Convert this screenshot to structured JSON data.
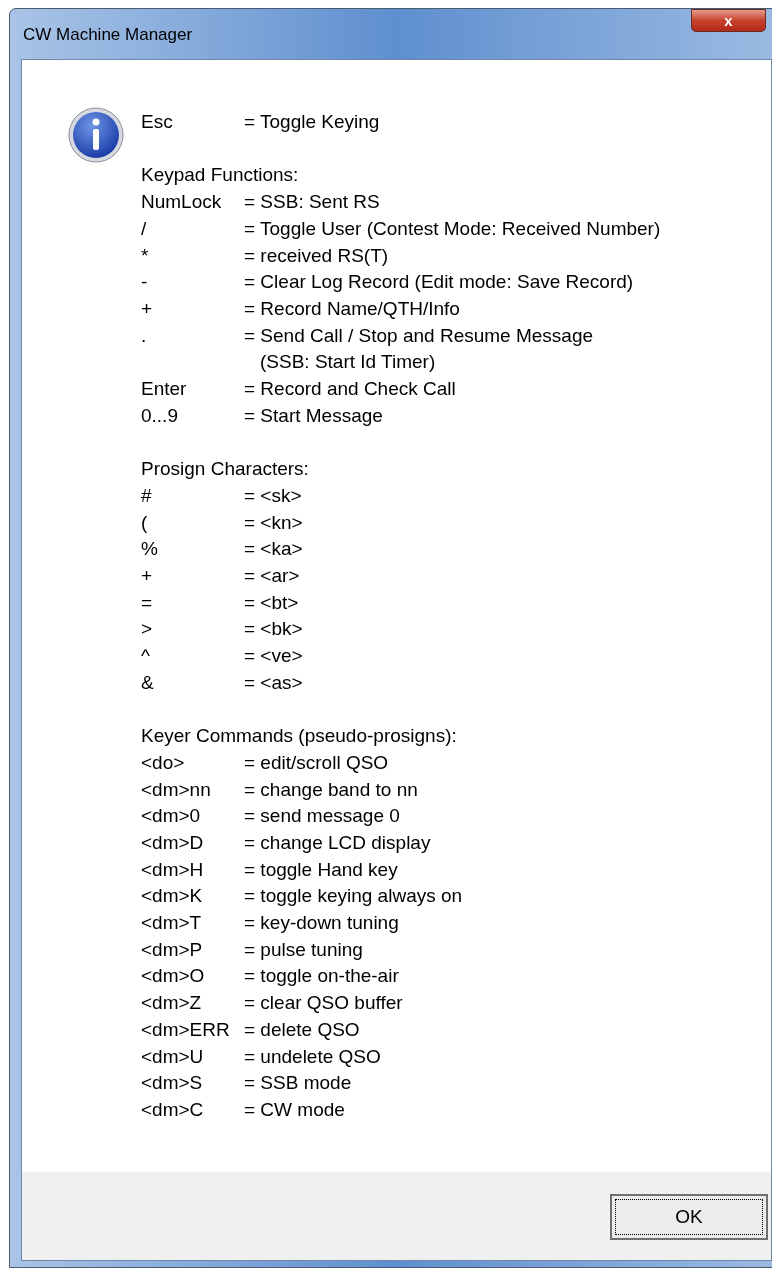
{
  "window": {
    "title": "CW Machine Manager",
    "close": "x"
  },
  "sections": [
    {
      "rows": [
        {
          "key": "Esc",
          "lines": [
            "= Toggle Keying"
          ]
        }
      ]
    },
    {
      "heading": "Keypad Functions:",
      "rows": [
        {
          "key": "NumLock",
          "lines": [
            "= SSB: Sent RS"
          ]
        },
        {
          "key": "/",
          "lines": [
            "= Toggle User (Contest Mode: Received Number)"
          ]
        },
        {
          "key": "*",
          "lines": [
            "= received RS(T)"
          ]
        },
        {
          "key": "-",
          "lines": [
            "= Clear Log Record (Edit mode: Save Record)"
          ]
        },
        {
          "key": "+",
          "lines": [
            "= Record Name/QTH/Info"
          ]
        },
        {
          "key": ".",
          "lines": [
            "= Send Call / Stop and Resume Message",
            "(SSB: Start Id Timer)"
          ]
        },
        {
          "key": "Enter",
          "lines": [
            "= Record and Check Call"
          ]
        },
        {
          "key": "0...9",
          "lines": [
            "= Start Message"
          ]
        }
      ]
    },
    {
      "heading": "Prosign Characters:",
      "rows": [
        {
          "key": "#",
          "lines": [
            "= <sk>"
          ]
        },
        {
          "key": "(",
          "lines": [
            "= <kn>"
          ]
        },
        {
          "key": "%",
          "lines": [
            "= <ka>"
          ]
        },
        {
          "key": "+",
          "lines": [
            "= <ar>"
          ]
        },
        {
          "key": "=",
          "lines": [
            "= <bt>"
          ]
        },
        {
          "key": ">",
          "lines": [
            "= <bk>"
          ]
        },
        {
          "key": "^",
          "lines": [
            "= <ve>"
          ]
        },
        {
          "key": "&",
          "lines": [
            "= <as>"
          ]
        }
      ]
    },
    {
      "heading": "Keyer Commands (pseudo-prosigns):",
      "rows": [
        {
          "key": "<do>",
          "lines": [
            "= edit/scroll QSO"
          ]
        },
        {
          "key": "<dm>nn",
          "lines": [
            "= change band to nn"
          ]
        },
        {
          "key": "<dm>0",
          "lines": [
            "= send message 0"
          ]
        },
        {
          "key": "<dm>D",
          "lines": [
            "= change LCD display"
          ]
        },
        {
          "key": "<dm>H",
          "lines": [
            "= toggle Hand key"
          ]
        },
        {
          "key": "<dm>K",
          "lines": [
            "= toggle keying always on"
          ]
        },
        {
          "key": "<dm>T",
          "lines": [
            "= key-down tuning"
          ]
        },
        {
          "key": "<dm>P",
          "lines": [
            "= pulse tuning"
          ]
        },
        {
          "key": "<dm>O",
          "lines": [
            "= toggle on-the-air"
          ]
        },
        {
          "key": "<dm>Z",
          "lines": [
            "= clear QSO buffer"
          ]
        },
        {
          "key": "<dm>ERR",
          "lines": [
            "= delete QSO"
          ]
        },
        {
          "key": "<dm>U",
          "lines": [
            "= undelete QSO"
          ]
        },
        {
          "key": "<dm>S",
          "lines": [
            "= SSB mode"
          ]
        },
        {
          "key": "<dm>C",
          "lines": [
            "= CW mode"
          ]
        }
      ]
    }
  ],
  "buttons": [
    {
      "label": "OK",
      "focused": true
    }
  ]
}
